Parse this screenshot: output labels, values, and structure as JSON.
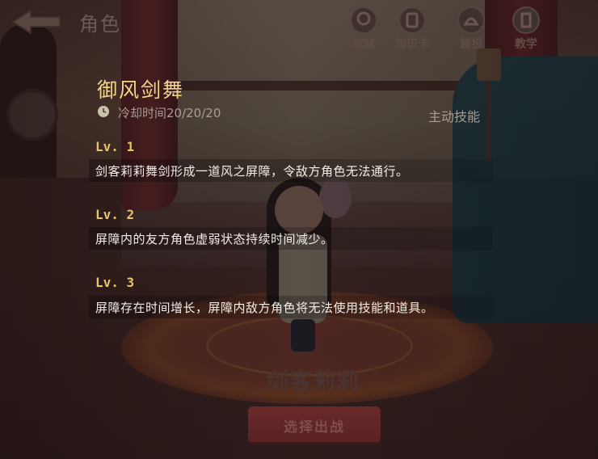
{
  "header": {
    "title": "角色",
    "back_icon": "back-arrow-icon"
  },
  "topnav": {
    "items": [
      {
        "label": "成就",
        "icon": "achievement-icon"
      },
      {
        "label": "知识卡",
        "icon": "knowledge-card-icon"
      },
      {
        "label": "装扮",
        "icon": "costume-icon"
      },
      {
        "label": "教学",
        "icon": "tutorial-icon"
      }
    ]
  },
  "skill": {
    "name": "御风剑舞",
    "cooldown_icon": "clock-icon",
    "cooldown_text": "冷却时间20/20/20",
    "type": "主动技能",
    "levels": [
      {
        "level": "Lv. 1",
        "description": "剑客莉莉舞剑形成一道风之屏障，令敌方角色无法通行。"
      },
      {
        "level": "Lv. 2",
        "description": "屏障内的友方角色虚弱状态持续时间减少。"
      },
      {
        "level": "Lv. 3",
        "description": "屏障存在时间增长，屏障内敌方角色将无法使用技能和道具。"
      }
    ]
  },
  "character": {
    "name": "剑客莉莉"
  },
  "actions": {
    "select_label": "选择出战"
  },
  "colors": {
    "title_gold": "#f2d58a",
    "level_gold": "#e8c36a",
    "desc_white": "#f4ede8",
    "muted": "#a99c94"
  }
}
